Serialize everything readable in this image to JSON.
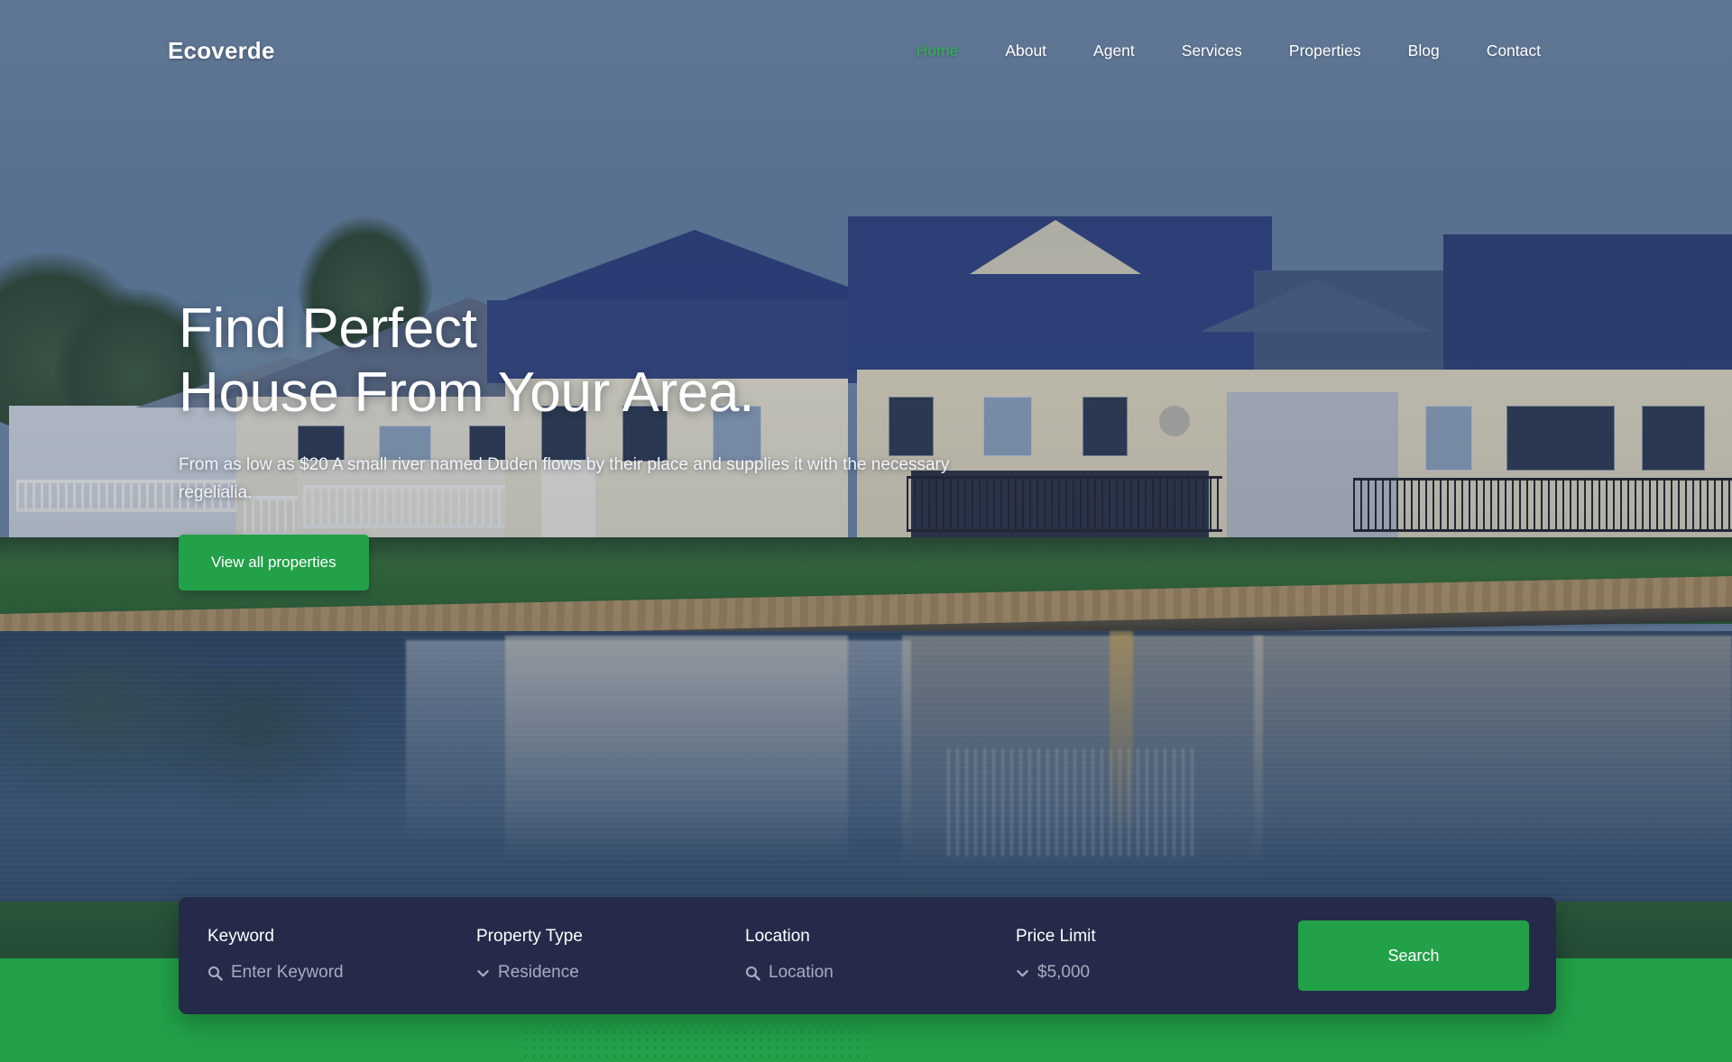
{
  "site": {
    "brand": "Ecoverde",
    "accent_green": "#22a148",
    "panel_navy": "#252a4a"
  },
  "nav": {
    "items": [
      {
        "label": "Home",
        "active": true
      },
      {
        "label": "About",
        "active": false
      },
      {
        "label": "Agent",
        "active": false
      },
      {
        "label": "Services",
        "active": false
      },
      {
        "label": "Properties",
        "active": false
      },
      {
        "label": "Blog",
        "active": false
      },
      {
        "label": "Contact",
        "active": false
      }
    ]
  },
  "hero": {
    "heading_line1": "Find Perfect",
    "heading_line2": "House From Your Area.",
    "paragraph": "From as low as $20 A small river named Duden flows by their place and supplies it with the necessary regelialia.",
    "cta_label": "View all properties"
  },
  "search": {
    "fields": [
      {
        "label": "Keyword",
        "value": "Enter Keyword",
        "icon": "search-icon"
      },
      {
        "label": "Property Type",
        "value": "Residence",
        "icon": "chevron-down-icon"
      },
      {
        "label": "Location",
        "value": "Location",
        "icon": "search-icon"
      },
      {
        "label": "Price Limit",
        "value": "$5,000",
        "icon": "chevron-down-icon"
      }
    ],
    "submit_label": "Search"
  }
}
